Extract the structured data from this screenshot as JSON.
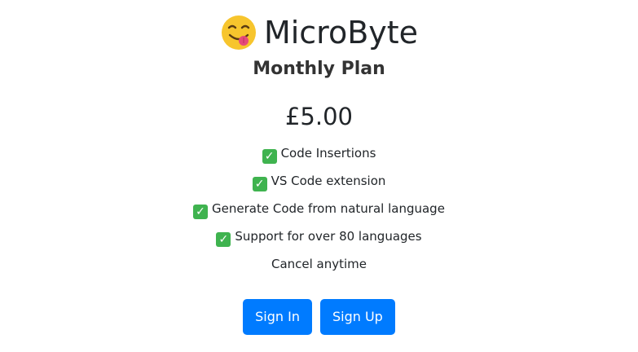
{
  "header": {
    "emoji": "savoring-food-face-emoji",
    "title": "MicroByte"
  },
  "plan": {
    "name": "Monthly Plan",
    "price": "£5.00"
  },
  "features": [
    {
      "icon": "check-mark-icon",
      "text": "Code Insertions"
    },
    {
      "icon": "check-mark-icon",
      "text": "VS Code extension"
    },
    {
      "icon": "check-mark-icon",
      "text": "Generate Code from natural language"
    },
    {
      "icon": "check-mark-icon",
      "text": "Support for over 80 languages"
    }
  ],
  "cancel_note": "Cancel anytime",
  "actions": {
    "sign_in_label": "Sign In",
    "sign_up_label": "Sign Up"
  },
  "colors": {
    "button": "#007bff",
    "check": "#3fb34f",
    "text": "#212529"
  }
}
